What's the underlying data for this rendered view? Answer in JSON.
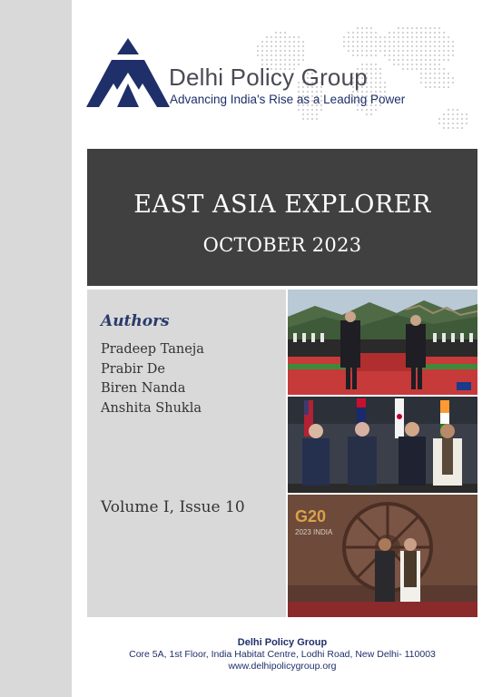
{
  "header": {
    "org_name": "Delhi Policy Group",
    "tagline": "Advancing India's Rise as a Leading Power"
  },
  "report": {
    "title": "EAST ASIA EXPLORER",
    "date": "OCTOBER 2023"
  },
  "authors": {
    "heading": "Authors",
    "names": [
      "Pradeep Taneja",
      "Prabir De",
      "Biren Nanda",
      "Anshita Shukla"
    ]
  },
  "issue": {
    "volume_label": "Volume I, Issue 10"
  },
  "photos": {
    "photo3_overlay": "2023 INDIA"
  },
  "footer": {
    "org": "Delhi Policy Group",
    "address": "Core 5A, 1st Floor, India Habitat Centre, Lodhi Road, New Delhi- 110003",
    "website": "www.delhipolicygroup.org"
  },
  "colors": {
    "brand_navy": "#1f2f6a",
    "band_gray": "#404040",
    "panel_gray": "#d9d9d9"
  }
}
